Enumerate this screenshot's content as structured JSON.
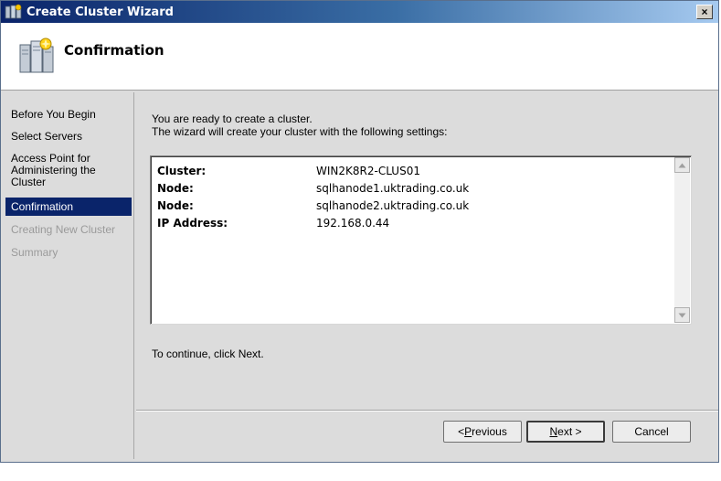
{
  "window": {
    "title": "Create Cluster Wizard",
    "close_glyph": "×"
  },
  "header": {
    "title": "Confirmation",
    "icon": "cluster-servers-icon"
  },
  "nav": {
    "items": [
      {
        "label": "Before You Begin",
        "state": "normal"
      },
      {
        "label": "Select Servers",
        "state": "normal"
      },
      {
        "label": "Access Point for Administering the Cluster",
        "state": "normal"
      },
      {
        "label": "Confirmation",
        "state": "selected"
      },
      {
        "label": "Creating New Cluster",
        "state": "disabled"
      },
      {
        "label": "Summary",
        "state": "disabled"
      }
    ]
  },
  "main": {
    "intro_line1": "You are ready to create a cluster.",
    "intro_line2": "The wizard will create your cluster with the following settings:",
    "settings": [
      {
        "label": "Cluster:",
        "value": "WIN2K8R2-CLUS01"
      },
      {
        "label": "Node:",
        "value": "sqlhanode1.uktrading.co.uk"
      },
      {
        "label": "Node:",
        "value": "sqlhanode2.uktrading.co.uk"
      },
      {
        "label": "IP Address:",
        "value": "192.168.0.44"
      }
    ],
    "continue_text": "To continue, click Next."
  },
  "buttons": {
    "previous_prefix": "< ",
    "previous_mnemonic": "P",
    "previous_rest": "revious",
    "next_mnemonic": "N",
    "next_rest": "ext >",
    "cancel": "Cancel"
  },
  "colors": {
    "selection": "#0a246a",
    "disabled_text": "#9a9a9a",
    "titlebar": "#0a246a"
  }
}
